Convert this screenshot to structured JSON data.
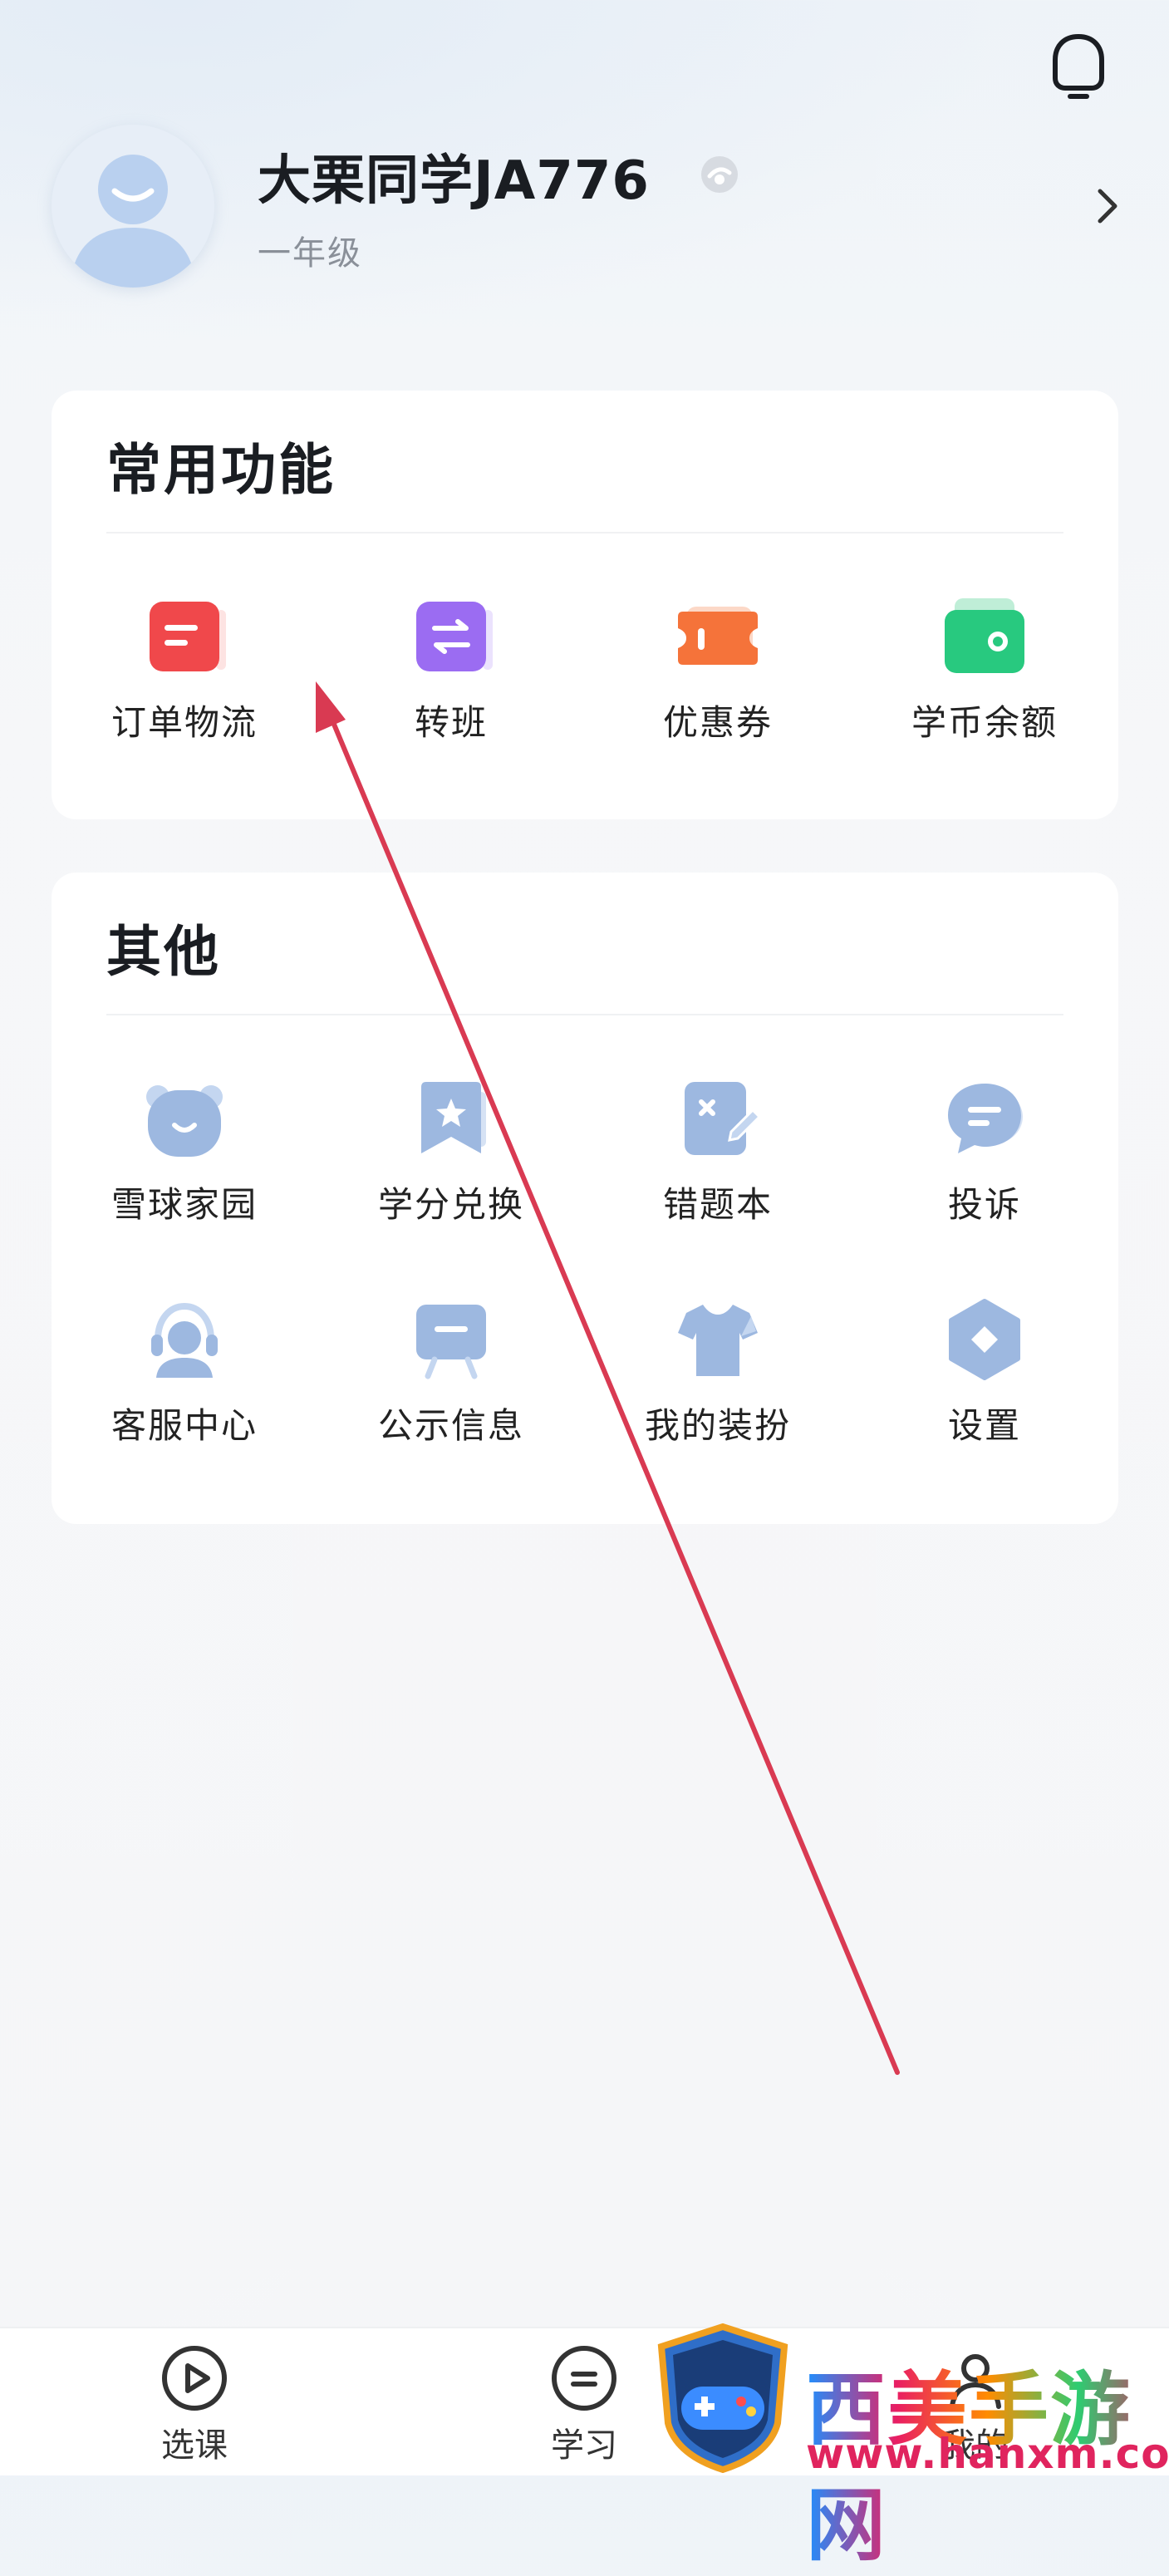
{
  "profile": {
    "name": "大栗同学JA776",
    "grade": "一年级"
  },
  "common": {
    "title": "常用功能",
    "items": [
      {
        "label": "订单物流",
        "icon": "order-icon",
        "color": "#f0484b"
      },
      {
        "label": "转班",
        "icon": "transfer-class-icon",
        "color": "#9b6cf2"
      },
      {
        "label": "优惠券",
        "icon": "coupon-icon",
        "color": "#f5733a"
      },
      {
        "label": "学币余额",
        "icon": "wallet-icon",
        "color": "#28c97f"
      }
    ]
  },
  "other": {
    "title": "其他",
    "items": [
      {
        "label": "雪球家园",
        "icon": "bear-icon"
      },
      {
        "label": "学分兑换",
        "icon": "star-bookmark-icon"
      },
      {
        "label": "错题本",
        "icon": "notebook-icon"
      },
      {
        "label": "投诉",
        "icon": "chat-icon"
      },
      {
        "label": "客服中心",
        "icon": "headset-icon"
      },
      {
        "label": "公示信息",
        "icon": "notice-board-icon"
      },
      {
        "label": "我的装扮",
        "icon": "shirt-icon"
      },
      {
        "label": "设置",
        "icon": "gear-icon"
      }
    ]
  },
  "tabbar": {
    "items": [
      {
        "label": "选课",
        "icon": "play-icon"
      },
      {
        "label": "学习",
        "icon": "study-icon"
      },
      {
        "label": "我的",
        "icon": "profile-icon"
      }
    ]
  },
  "watermark": {
    "text": "西美手游网",
    "url": "www.hanxm.com"
  },
  "colors": {
    "icon_blue": "#9db8e0",
    "annotation_arrow": "#d93a52"
  }
}
